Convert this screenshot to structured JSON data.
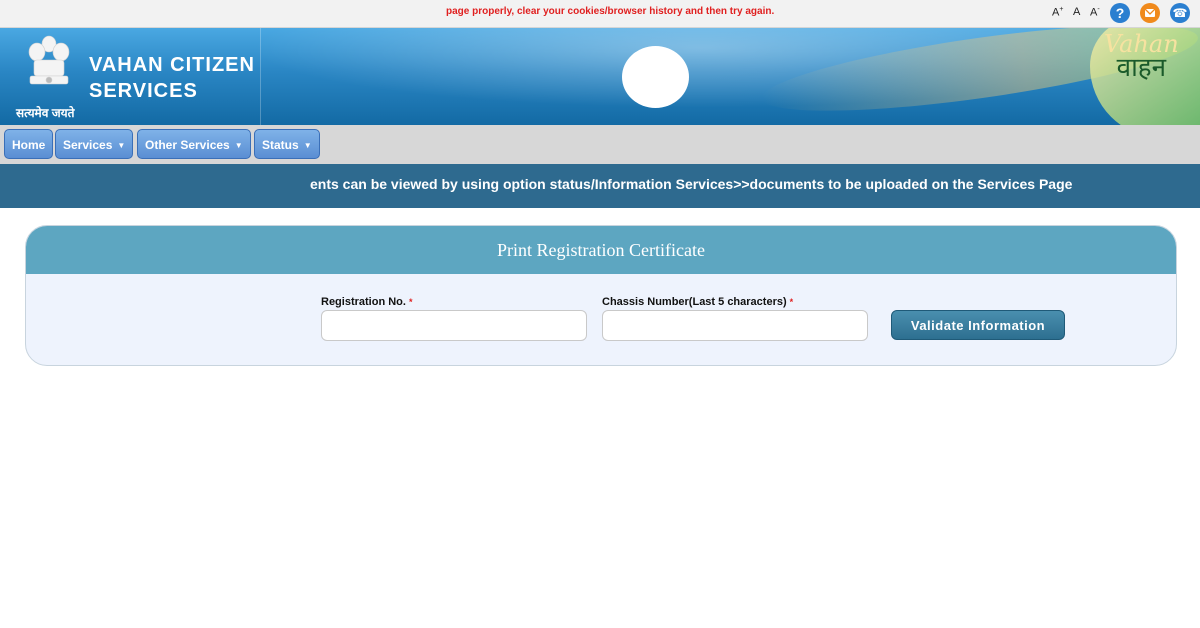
{
  "topbar": {
    "notice": "page properly, clear your cookies/browser history and then try again.",
    "font_increase": "A",
    "font_normal": "A",
    "font_decrease": "A",
    "help_glyph": "?",
    "phone_glyph": "☎"
  },
  "header": {
    "title_line1": "VAHAN CITIZEN",
    "title_line2": "SERVICES",
    "motto": "सत्यमेव जयते",
    "logo_en": "Vahan",
    "logo_hi": "वाहन"
  },
  "nav": {
    "items": [
      {
        "label": "Home"
      },
      {
        "label": "Services"
      },
      {
        "label": "Other Services"
      },
      {
        "label": "Status"
      }
    ]
  },
  "marquee": {
    "text": "ents can be viewed by using option status/Information Services>>documents to be uploaded on the Services Page"
  },
  "form": {
    "title": "Print Registration Certificate",
    "registration_label": "Registration No.",
    "registration_value": "",
    "chassis_label": "Chassis Number(Last 5 characters)",
    "chassis_value": "",
    "required_mark": "*",
    "submit_label": "Validate Information"
  },
  "colors": {
    "header_blue": "#2a86c4",
    "nav_button": "#5a8ed3",
    "marquee_bg": "#2e6a8f",
    "panel_head": "#5da6c1",
    "required_red": "#e02020"
  }
}
